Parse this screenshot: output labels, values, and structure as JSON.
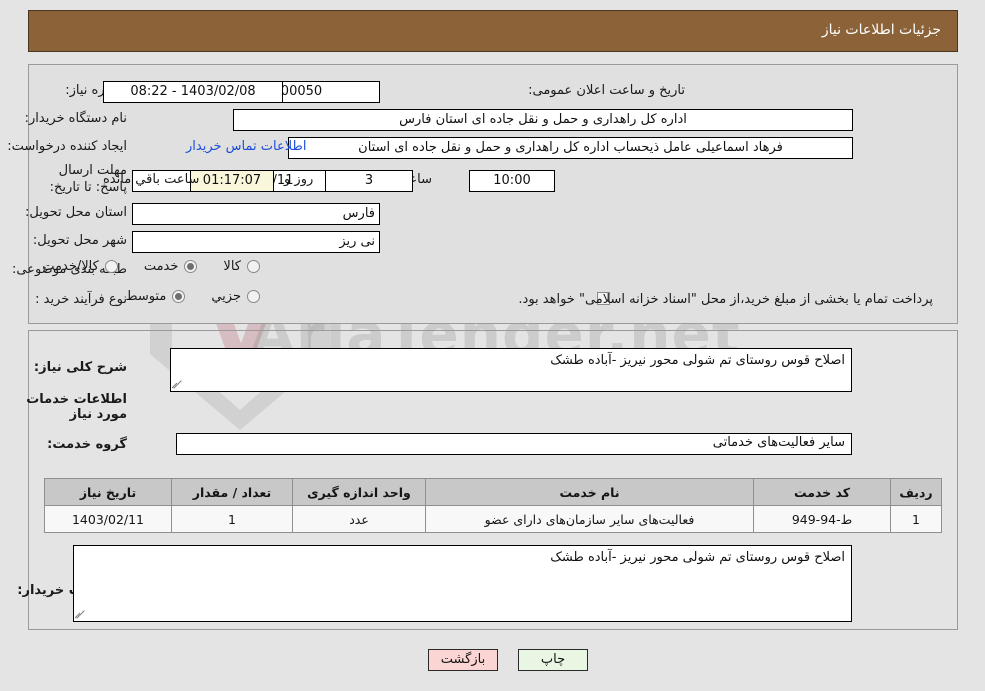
{
  "header": {
    "title": "جزئیات اطلاعات نیاز"
  },
  "form": {
    "need_number_label": "شماره نیاز:",
    "need_number_value": "1103001044000050",
    "announce_datetime_label": "تاریخ و ساعت اعلان عمومی:",
    "announce_datetime_value": "1403/02/08 - 08:22",
    "buyer_org_label": "نام دستگاه خریدار:",
    "buyer_org_value": "اداره کل راهداری و حمل و نقل جاده ای استان فارس",
    "requester_label": "ایجاد کننده درخواست:",
    "requester_value": "فرهاد اسماعیلی عامل ذیحساب اداره کل راهداری و حمل و نقل جاده ای استان",
    "buyer_contact_link": "اطلاعات تماس خریدار",
    "deadline_label": "مهلت ارسال پاسخ: تا تاریخ:",
    "deadline_date": "1403/02/11",
    "deadline_hour_label": "ساعت",
    "deadline_hour_value": "10:00",
    "remaining_days": "3",
    "remaining_days_label": "روز و",
    "remaining_time": "01:17:07",
    "remaining_suffix_label": "ساعت باقي مانده",
    "province_label": "استان محل تحویل:",
    "province_value": "فارس",
    "city_label": "شهر محل تحویل:",
    "city_value": "نی ریز",
    "category_label": "طبقه بندی موضوعی:",
    "category_options": [
      {
        "label": "کالا",
        "selected": false
      },
      {
        "label": "خدمت",
        "selected": true
      },
      {
        "label": "کالا/خدمت",
        "selected": false
      }
    ],
    "process_label": "نوع فرآیند خرید :",
    "process_options": [
      {
        "label": "جزیي",
        "selected": false
      },
      {
        "label": "متوسط",
        "selected": true
      }
    ],
    "treasury_checkbox_label": "پرداخت تمام یا بخشی از مبلغ خرید،از محل \"اسناد خزانه اسلامی\" خواهد بود.",
    "treasury_checked": false
  },
  "summary": {
    "label": "شرح کلی نیاز:",
    "value": "اصلاح قوس روستای تم شولی محور نیریز -آباده طشک"
  },
  "services_section": {
    "heading": "اطلاعات خدمات مورد نیاز",
    "group_label": "گروه خدمت:",
    "group_value": "سایر فعالیت‌های خدماتی"
  },
  "table": {
    "columns": [
      "ردیف",
      "کد خدمت",
      "نام خدمت",
      "واحد اندازه گیری",
      "تعداد / مقدار",
      "تاریخ نیاز"
    ],
    "rows": [
      {
        "row_no": "1",
        "service_code": "ط-94-949",
        "service_name": "فعالیت‌های سایر سازمان‌های دارای عضو",
        "unit": "عدد",
        "quantity": "1",
        "need_date": "1403/02/11"
      }
    ]
  },
  "buyer_notes": {
    "label": "توضیحات خریدار:",
    "value": "اصلاح قوس روستای تم شولی محور نیریز -آباده طشک"
  },
  "footer": {
    "print_label": "چاپ",
    "back_label": "بازگشت"
  },
  "watermark": {
    "text": "AriaTender.net",
    "mark": "V"
  },
  "colors": {
    "header_bg": "#8c6239",
    "page_bg": "#e4e4e4",
    "panel_bg": "#e0e0e0",
    "link": "#1c4fd8",
    "table_header_bg": "#c8c8c8",
    "print_btn_bg": "#e8f6e3",
    "back_btn_bg": "#fbd4d4",
    "highlight_field_bg": "#faf6dc"
  }
}
